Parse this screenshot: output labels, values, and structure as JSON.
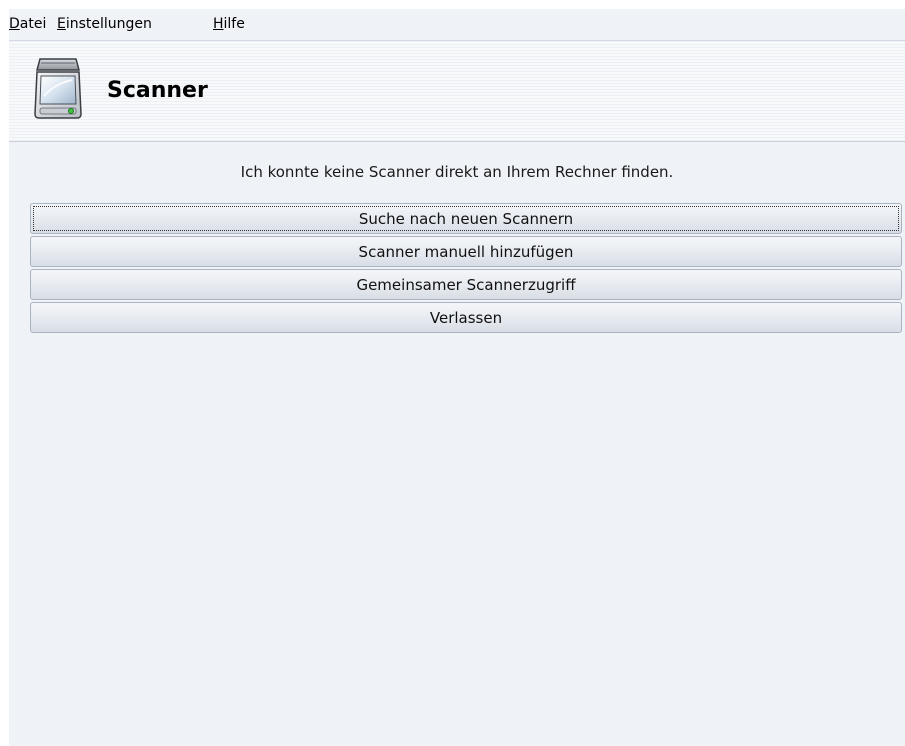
{
  "menubar": {
    "items": [
      {
        "mnemonic": "D",
        "rest": "atei"
      },
      {
        "mnemonic": "E",
        "rest": "instellungen"
      },
      {
        "mnemonic": "H",
        "rest": "ilfe"
      }
    ]
  },
  "header": {
    "title": "Scanner",
    "icon": "scanner-icon"
  },
  "main": {
    "message": "Ich konnte keine Scanner direkt an Ihrem Rechner finden.",
    "buttons": [
      {
        "label": "Suche nach neuen Scannern"
      },
      {
        "label": "Scanner manuell hinzufügen"
      },
      {
        "label": "Gemeinsamer Scannerzugriff"
      },
      {
        "label": "Verlassen"
      }
    ]
  },
  "colors": {
    "background": "#eff2f6",
    "button_border": "#aab3c0"
  }
}
